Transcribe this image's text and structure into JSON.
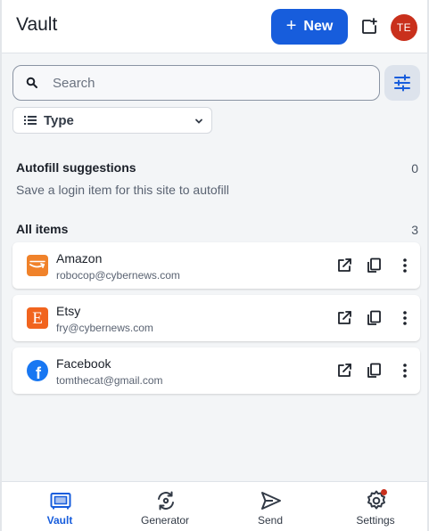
{
  "header": {
    "title": "Vault",
    "new_label": "New",
    "avatar_initials": "TE",
    "avatar_color": "#c9301c",
    "accent": "#175ddc"
  },
  "search": {
    "placeholder": "Search",
    "value": ""
  },
  "filter": {
    "type_label": "Type"
  },
  "autofill": {
    "title": "Autofill suggestions",
    "count": "0",
    "description": "Save a login item for this site to autofill"
  },
  "all_items": {
    "title": "All items",
    "count": "3",
    "items": [
      {
        "name": "Amazon",
        "username": "robocop@cybernews.com",
        "icon": "amazon-logo"
      },
      {
        "name": "Etsy",
        "username": "fry@cybernews.com",
        "icon": "etsy-logo"
      },
      {
        "name": "Facebook",
        "username": "tomthecat@gmail.com",
        "icon": "facebook-logo"
      }
    ]
  },
  "nav": [
    {
      "label": "Vault",
      "icon": "vault-icon",
      "active": true
    },
    {
      "label": "Generator",
      "icon": "generator-icon",
      "active": false
    },
    {
      "label": "Send",
      "icon": "send-icon",
      "active": false
    },
    {
      "label": "Settings",
      "icon": "settings-icon",
      "active": false
    }
  ]
}
